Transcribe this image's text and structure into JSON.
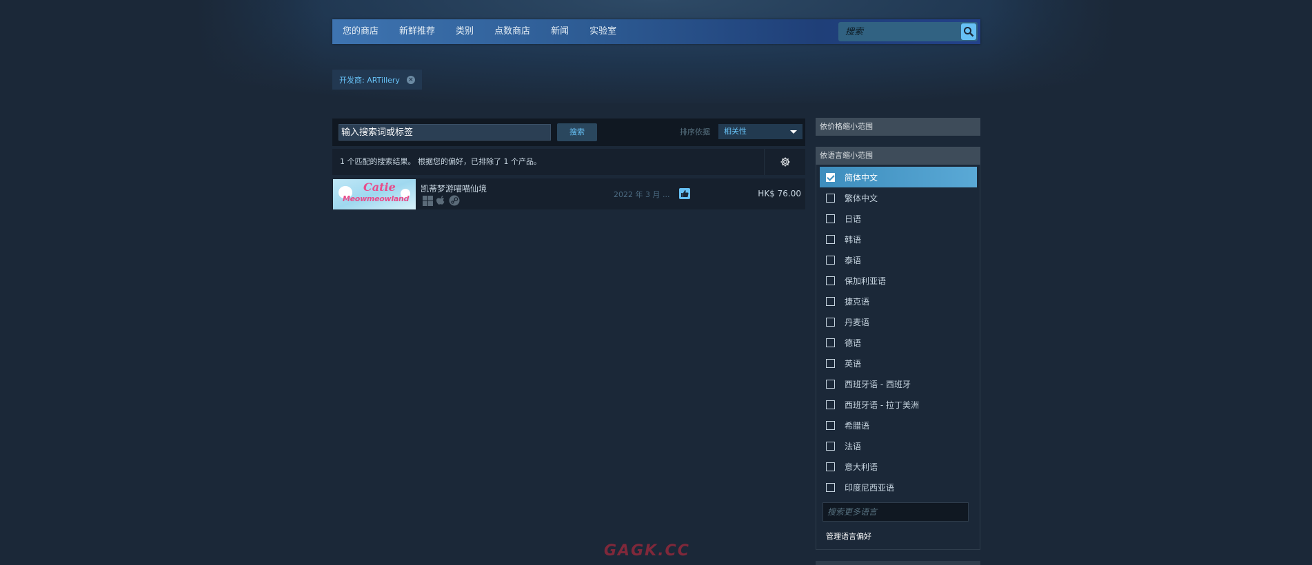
{
  "nav": {
    "items": [
      "您的商店",
      "新鲜推荐",
      "类别",
      "点数商店",
      "新闻",
      "实验室"
    ],
    "search_placeholder": "搜索"
  },
  "filter_tag": {
    "label": "开发商: ARTillery",
    "remove_icon": "close-icon"
  },
  "search_bar": {
    "term_placeholder": "输入搜索词或标签",
    "search_button": "搜索",
    "sort_label": "排序依据",
    "sort_value": "相关性"
  },
  "results": {
    "summary": "1 个匹配的搜索结果。 根据您的偏好，已排除了 1 个产品。",
    "items": [
      {
        "title": "凯蒂梦游喵喵仙境",
        "capsule_text_1": "Catie",
        "capsule_text_2": "Meowmeowland",
        "platforms": [
          "windows-icon",
          "apple-icon",
          "steam-icon"
        ],
        "release_date": "2022 年 3 月 ...",
        "review_icon": "thumbs-up-icon",
        "price": "HK$ 76.00"
      }
    ]
  },
  "filters": {
    "price_header": "依价格缩小范围",
    "language_header": "依语言缩小范围",
    "languages": [
      {
        "label": "简体中文",
        "checked": true
      },
      {
        "label": "繁体中文",
        "checked": false
      },
      {
        "label": "日语",
        "checked": false
      },
      {
        "label": "韩语",
        "checked": false
      },
      {
        "label": "泰语",
        "checked": false
      },
      {
        "label": "保加利亚语",
        "checked": false
      },
      {
        "label": "捷克语",
        "checked": false
      },
      {
        "label": "丹麦语",
        "checked": false
      },
      {
        "label": "德语",
        "checked": false
      },
      {
        "label": "英语",
        "checked": false
      },
      {
        "label": "西班牙语 - 西班牙",
        "checked": false
      },
      {
        "label": "西班牙语 - 拉丁美洲",
        "checked": false
      },
      {
        "label": "希腊语",
        "checked": false
      },
      {
        "label": "法语",
        "checked": false
      },
      {
        "label": "意大利语",
        "checked": false
      },
      {
        "label": "印度尼西亚语",
        "checked": false
      }
    ],
    "language_search_placeholder": "搜索更多语言",
    "manage_link": "管理语言偏好"
  },
  "watermark": "GAGK.CC",
  "colors": {
    "background": "#1b2838",
    "accent": "#67c1f5",
    "nav_start": "#3e74b1",
    "checked_row": "#3d8dbd"
  }
}
